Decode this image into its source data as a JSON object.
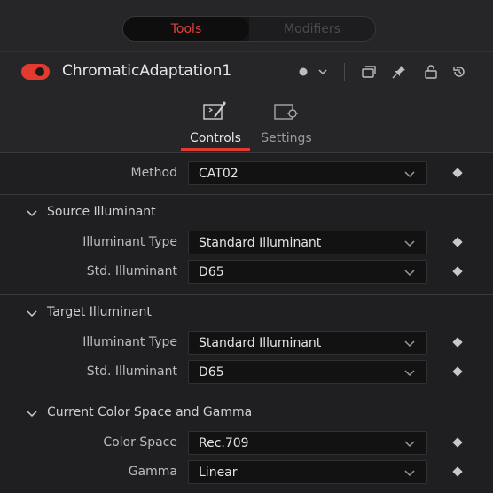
{
  "top_tabs": {
    "tools": "Tools",
    "modifiers": "Modifiers"
  },
  "node": {
    "name": "ChromaticAdaptation1"
  },
  "subtabs": {
    "controls": "Controls",
    "settings": "Settings"
  },
  "method": {
    "label": "Method",
    "value": "CAT02"
  },
  "source": {
    "title": "Source Illuminant",
    "type_label": "Illuminant Type",
    "type_value": "Standard Illuminant",
    "std_label": "Std. Illuminant",
    "std_value": "D65"
  },
  "target": {
    "title": "Target Illuminant",
    "type_label": "Illuminant Type",
    "type_value": "Standard Illuminant",
    "std_label": "Std. Illuminant",
    "std_value": "D65"
  },
  "colorspace": {
    "title": "Current Color Space and Gamma",
    "space_label": "Color Space",
    "space_value": "Rec.709",
    "gamma_label": "Gamma",
    "gamma_value": "Linear"
  },
  "colors": {
    "accent": "#e33a2f",
    "background": "#1f1f21"
  }
}
